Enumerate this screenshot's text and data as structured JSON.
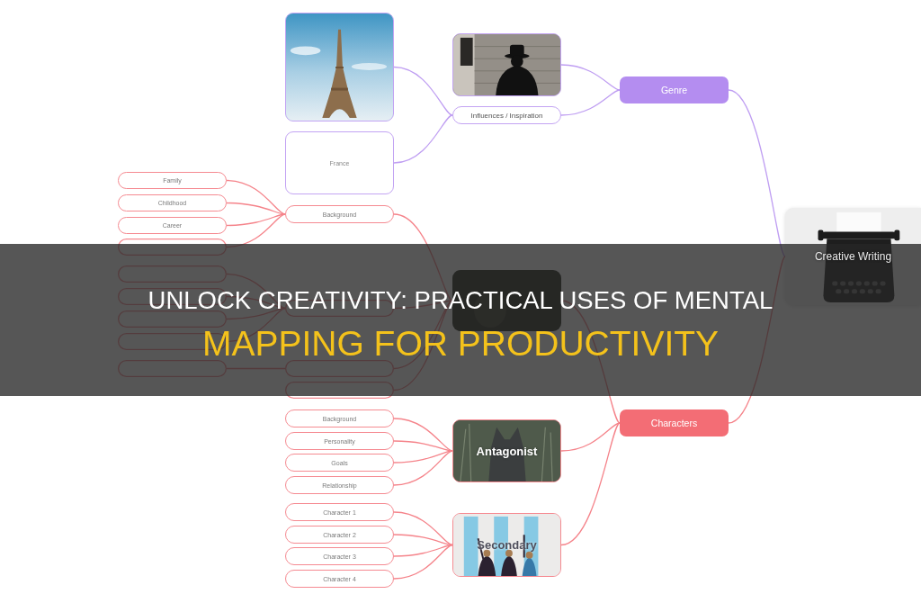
{
  "mind_map": {
    "root": {
      "kind": "typewriter",
      "label": "Creative Writing",
      "children": [
        {
          "kind": "topic",
          "label": "Genre",
          "color": "#b48df0",
          "children": [
            {
              "kind": "silhouette"
            },
            {
              "kind": "pill",
              "label": "Influences / Inspiration",
              "children": [
                {
                  "kind": "tower"
                },
                {
                  "kind": "card",
                  "label": "France"
                }
              ]
            }
          ]
        },
        {
          "kind": "topic",
          "label": "Characters",
          "color": "#f36d75",
          "children": [
            {
              "kind": "dark",
              "children": [
                {
                  "kind": "pill",
                  "label": "Background",
                  "children": [
                    {
                      "kind": "pill",
                      "label": "Family"
                    },
                    {
                      "kind": "pill",
                      "label": "Childhood"
                    },
                    {
                      "kind": "pill",
                      "label": "Career"
                    },
                    {
                      "kind": "pill"
                    }
                  ]
                },
                {
                  "kind": "pill",
                  "children": [
                    {
                      "kind": "pill"
                    },
                    {
                      "kind": "pill"
                    },
                    {
                      "kind": "pill"
                    },
                    {
                      "kind": "pill"
                    }
                  ]
                },
                {
                  "kind": "pill",
                  "children": [
                    {
                      "kind": "pill"
                    }
                  ]
                },
                {
                  "kind": "pill"
                }
              ]
            },
            {
              "kind": "cat",
              "label": "Antagonist",
              "children": [
                {
                  "kind": "pill",
                  "label": "Background"
                },
                {
                  "kind": "pill",
                  "label": "Personality"
                },
                {
                  "kind": "pill",
                  "label": "Goals"
                },
                {
                  "kind": "pill",
                  "label": "Relationship"
                }
              ]
            },
            {
              "kind": "stripes",
              "label": "Secondary",
              "children": [
                {
                  "kind": "pill",
                  "label": "Character 1"
                },
                {
                  "kind": "pill",
                  "label": "Character 2"
                },
                {
                  "kind": "pill",
                  "label": "Character 3"
                },
                {
                  "kind": "pill",
                  "label": "Character 4"
                }
              ]
            }
          ]
        }
      ]
    }
  },
  "banner": {
    "title_lines": [
      {
        "text": "UNLOCK CREATIVITY: PRACTICAL USES OF MENTAL",
        "accent": false
      },
      {
        "text": "MAPPING FOR PRODUCTIVITY",
        "accent": true
      }
    ]
  }
}
